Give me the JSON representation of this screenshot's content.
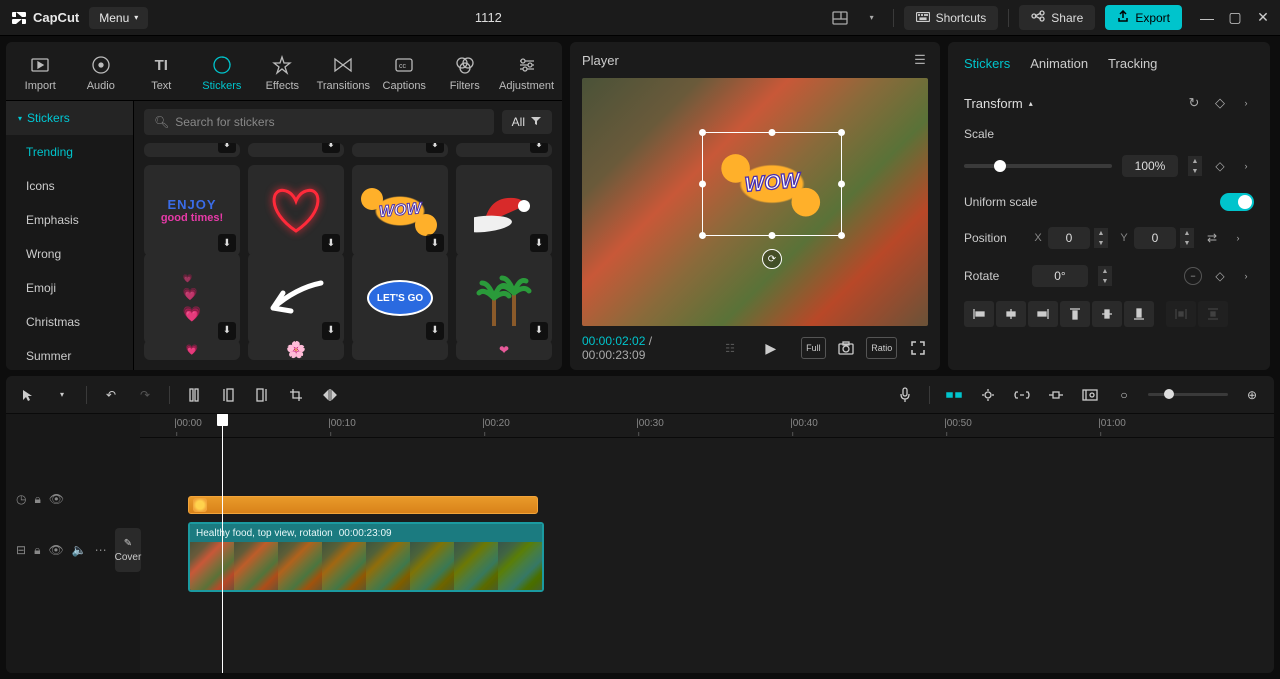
{
  "app": {
    "name": "CapCut",
    "menu_label": "Menu",
    "project_title": "1112"
  },
  "titlebar": {
    "shortcuts": "Shortcuts",
    "share": "Share",
    "export": "Export"
  },
  "media_tabs": [
    {
      "id": "import",
      "label": "Import"
    },
    {
      "id": "audio",
      "label": "Audio"
    },
    {
      "id": "text",
      "label": "Text"
    },
    {
      "id": "stickers",
      "label": "Stickers",
      "active": true
    },
    {
      "id": "effects",
      "label": "Effects"
    },
    {
      "id": "transitions",
      "label": "Transitions"
    },
    {
      "id": "captions",
      "label": "Captions"
    },
    {
      "id": "filters",
      "label": "Filters"
    },
    {
      "id": "adjustment",
      "label": "Adjustment"
    }
  ],
  "sticker_categories": {
    "header": "Stickers",
    "items": [
      "Trending",
      "Icons",
      "Emphasis",
      "Wrong",
      "Emoji",
      "Christmas",
      "Summer"
    ],
    "active": "Trending"
  },
  "search": {
    "placeholder": "Search for stickers"
  },
  "filter": {
    "all": "All"
  },
  "player": {
    "title": "Player",
    "current_time": "00:00:02:02",
    "total_time": "00:00:23:09",
    "full": "Full",
    "ratio": "Ratio",
    "overlay_text": "WOW"
  },
  "properties": {
    "tabs": [
      "Stickers",
      "Animation",
      "Tracking"
    ],
    "active_tab": "Stickers",
    "transform_label": "Transform",
    "scale_label": "Scale",
    "scale_value": "100%",
    "uniform_label": "Uniform scale",
    "position_label": "Position",
    "pos_x_label": "X",
    "pos_x_value": "0",
    "pos_y_label": "Y",
    "pos_y_value": "0",
    "rotate_label": "Rotate",
    "rotate_value": "0°"
  },
  "timeline": {
    "ruler": [
      "|00:00",
      "|00:10",
      "|00:20",
      "|00:30",
      "|00:40",
      "|00:50",
      "|01:00"
    ],
    "video_clip_name": "Healthy food, top view, rotation",
    "video_clip_duration": "00:00:23:09",
    "cover_label": "Cover"
  }
}
